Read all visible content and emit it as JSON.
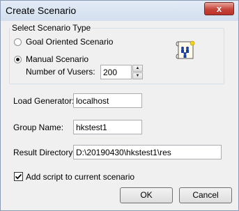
{
  "window": {
    "title": "Create Scenario",
    "close_label": "x"
  },
  "scenario_type": {
    "group_label": "Select Scenario Type",
    "goal_oriented_label": "Goal Oriented Scenario",
    "manual_label": "Manual Scenario",
    "vusers_label": "Number of Vusers:",
    "vusers_value": "200",
    "selected": "manual"
  },
  "load_generator": {
    "label": "Load Generator:",
    "value": "localhost"
  },
  "group_name": {
    "label": "Group Name:",
    "value": "hkstest1"
  },
  "result_directory": {
    "label": "Result Directory:",
    "value": "D:\\20190430\\hkstest1\\res"
  },
  "add_script": {
    "label": "Add script to current scenario",
    "checked": true
  },
  "buttons": {
    "ok": "OK",
    "cancel": "Cancel"
  }
}
